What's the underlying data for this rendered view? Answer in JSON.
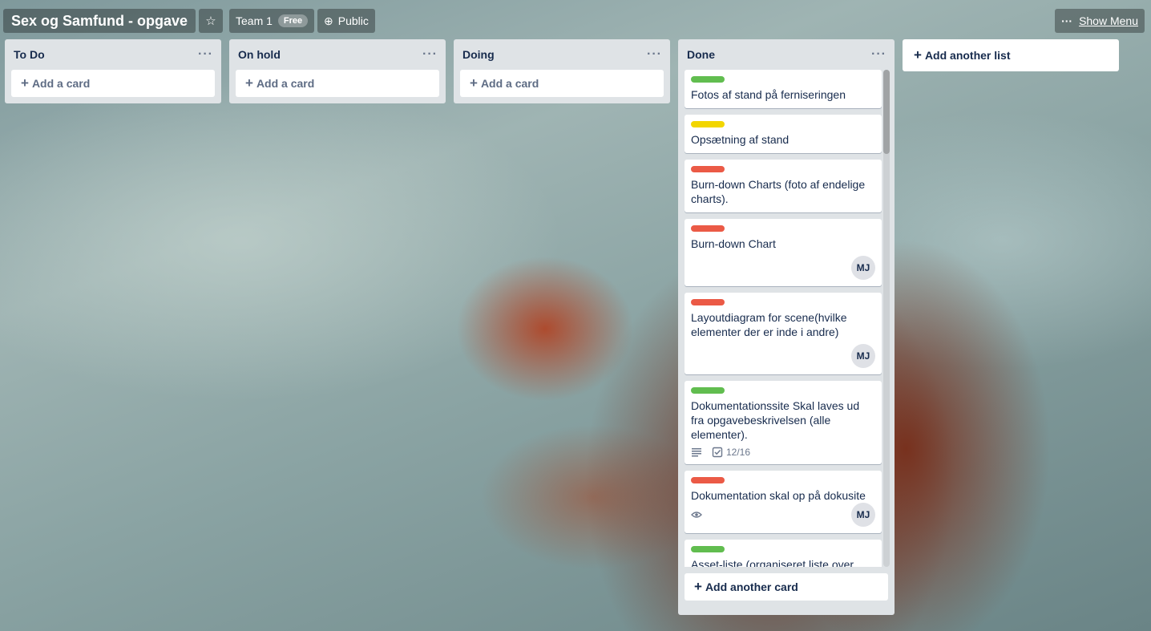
{
  "board": {
    "name": "Sex og Samfund - opgave",
    "team": "Team 1",
    "team_badge": "Free",
    "visibility": "Public",
    "show_menu": "Show Menu"
  },
  "lists": [
    {
      "title": "To Do",
      "add_card": "Add a card"
    },
    {
      "title": "On hold",
      "add_card": "Add a card"
    },
    {
      "title": "Doing",
      "add_card": "Add a card"
    },
    {
      "title": "Done",
      "add_card": "Add another card",
      "cards": [
        {
          "label_color": "#61bd4f",
          "title": "Fotos af stand på ferniseringen"
        },
        {
          "label_color": "#f2d600",
          "title": "Opsætning af stand"
        },
        {
          "label_color": "#eb5a46",
          "title": "Burn-down Charts (foto af endelige charts)."
        },
        {
          "label_color": "#eb5a46",
          "title": "Burn-down Chart",
          "member": "MJ"
        },
        {
          "label_color": "#eb5a46",
          "title": "Layoutdiagram for scene(hvilke elementer der er inde i andre)",
          "member": "MJ"
        },
        {
          "label_color": "#61bd4f",
          "title": "Dokumentationssite Skal laves ud fra opgavebeskrivelsen (alle elementer).",
          "checklist": "12/16"
        },
        {
          "label_color": "#eb5a46",
          "title": "Dokumentation skal op på dokusite",
          "member": "MJ"
        },
        {
          "label_color": "#61bd4f",
          "title": "Asset-liste (organiseret liste over"
        }
      ]
    }
  ],
  "add_list": "Add another list",
  "colors": {
    "label_green": "#61bd4f",
    "label_yellow": "#f2d600",
    "label_red": "#eb5a46"
  }
}
